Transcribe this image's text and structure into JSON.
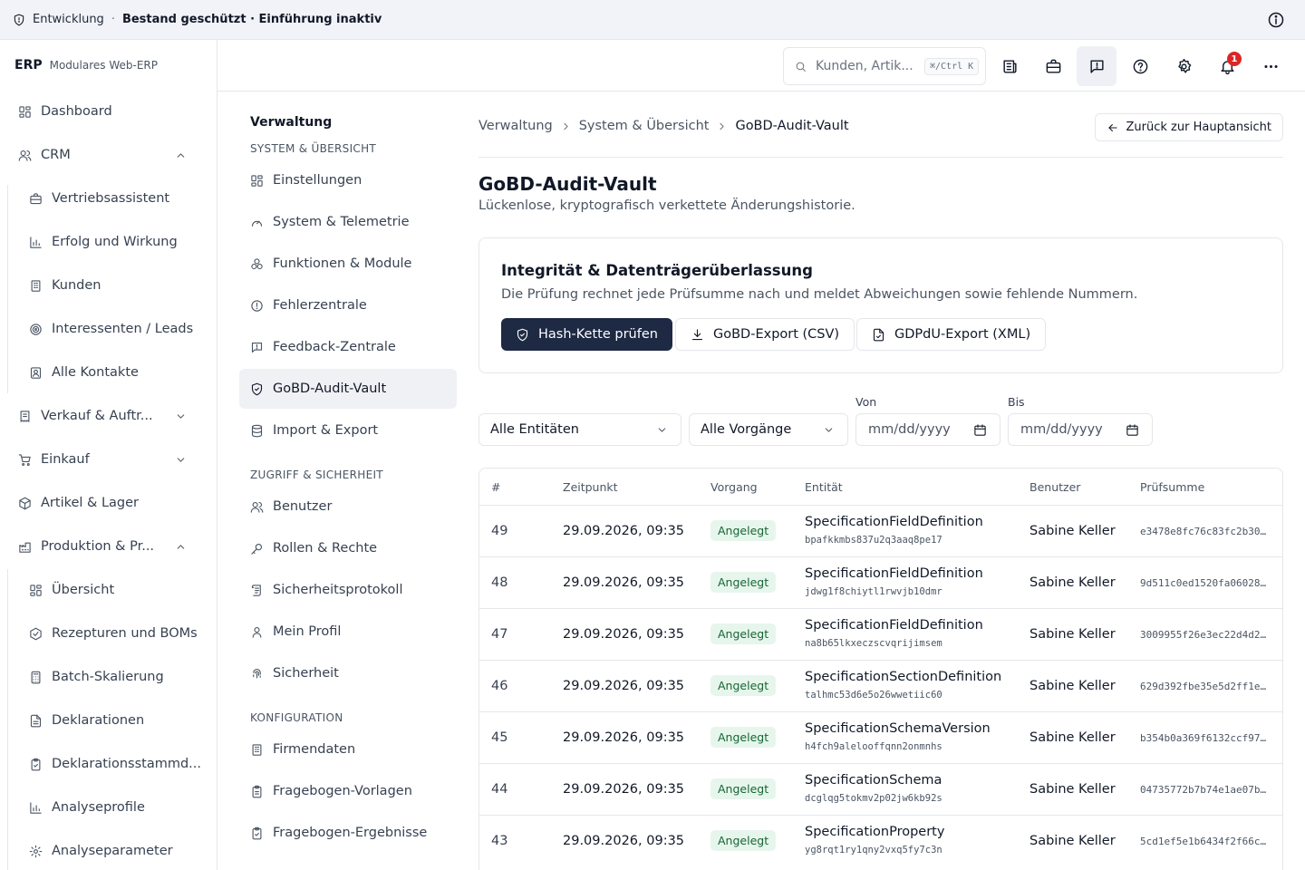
{
  "env": {
    "name": "Entwicklung",
    "separator": "·",
    "status": "Bestand geschützt · Einführung inaktiv"
  },
  "brand": {
    "short": "ERP",
    "long": "Modulares Web-ERP"
  },
  "sidebar": {
    "items": [
      {
        "label": "Dashboard",
        "icon": "dashboard-icon"
      },
      {
        "label": "CRM",
        "icon": "users-icon",
        "expanded": true
      },
      {
        "label": "Vertriebsassistent",
        "icon": "briefcase-icon"
      },
      {
        "label": "Erfolg und Wirkung",
        "icon": "bar-chart-icon"
      },
      {
        "label": "Kunden",
        "icon": "building-icon"
      },
      {
        "label": "Interessenten / Leads",
        "icon": "target-icon"
      },
      {
        "label": "Alle Kontakte",
        "icon": "contact-card-icon"
      },
      {
        "label": "Verkauf & Auftr...",
        "icon": "receipt-icon",
        "expanded": false
      },
      {
        "label": "Einkauf",
        "icon": "cart-icon",
        "expanded": false
      },
      {
        "label": "Artikel & Lager",
        "icon": "package-icon"
      },
      {
        "label": "Produktion & Pr...",
        "icon": "flask-icon",
        "expanded": true
      },
      {
        "label": "Übersicht",
        "icon": "dashboard-icon"
      },
      {
        "label": "Rezepturen und BOMs",
        "icon": "beaker-icon"
      },
      {
        "label": "Batch-Skalierung",
        "icon": "calculator-icon"
      },
      {
        "label": "Deklarationen",
        "icon": "file-text-icon"
      },
      {
        "label": "Deklarationsstammd...",
        "icon": "clipboard-check-icon"
      },
      {
        "label": "Analyseprofile",
        "icon": "bar-chart-icon"
      },
      {
        "label": "Analyseparameter",
        "icon": "gear-icon"
      }
    ]
  },
  "header": {
    "search_placeholder": "Kunden, Artik...",
    "search_shortcut": "⌘/Ctrl K",
    "notifications_count": "1"
  },
  "subnav": {
    "title": "Verwaltung",
    "sections": [
      {
        "label": "SYSTEM & ÜBERSICHT",
        "items": [
          {
            "label": "Einstellungen",
            "icon": "dashboard-icon"
          },
          {
            "label": "System & Telemetrie",
            "icon": "gauge-icon"
          },
          {
            "label": "Funktionen & Module",
            "icon": "modules-icon"
          },
          {
            "label": "Fehlerzentrale",
            "icon": "alert-circle-icon"
          },
          {
            "label": "Feedback-Zentrale",
            "icon": "feedback-icon"
          },
          {
            "label": "GoBD-Audit-Vault",
            "icon": "shield-check-icon",
            "active": true
          },
          {
            "label": "Import & Export",
            "icon": "database-icon"
          }
        ]
      },
      {
        "label": "ZUGRIFF & SICHERHEIT",
        "items": [
          {
            "label": "Benutzer",
            "icon": "users-icon"
          },
          {
            "label": "Rollen & Rechte",
            "icon": "key-icon"
          },
          {
            "label": "Sicherheitsprotokoll",
            "icon": "scroll-icon"
          },
          {
            "label": "Mein Profil",
            "icon": "user-icon"
          },
          {
            "label": "Sicherheit",
            "icon": "fingerprint-icon"
          }
        ]
      },
      {
        "label": "KONFIGURATION",
        "items": [
          {
            "label": "Firmendaten",
            "icon": "building-icon"
          },
          {
            "label": "Fragebogen-Vorlagen",
            "icon": "clipboard-icon"
          },
          {
            "label": "Fragebogen-Ergebnisse",
            "icon": "clipboard-check-icon"
          }
        ]
      }
    ]
  },
  "breadcrumb": [
    "Verwaltung",
    "System & Übersicht",
    "GoBD-Audit-Vault"
  ],
  "back_button": "Zurück zur Hauptansicht",
  "page": {
    "title": "GoBD-Audit-Vault",
    "subtitle": "Lückenlose, kryptografisch verkettete Änderungshistorie."
  },
  "integrity": {
    "title": "Integrität & Datenträgerüberlassung",
    "description": "Die Prüfung rechnet jede Prüfsumme nach und meldet Abweichungen sowie fehlende Nummern.",
    "buttons": {
      "verify": "Hash-Kette prüfen",
      "csv": "GoBD-Export (CSV)",
      "xml": "GDPdU-Export (XML)"
    }
  },
  "filters": {
    "entity": "Alle Entitäten",
    "action": "Alle Vorgänge",
    "from_label": "Von",
    "to_label": "Bis",
    "from_placeholder": "mm/dd/yyyy",
    "to_placeholder": "mm/dd/yyyy"
  },
  "table": {
    "columns": [
      "#",
      "Zeitpunkt",
      "Vorgang",
      "Entität",
      "Benutzer",
      "Prüfsumme"
    ],
    "rows": [
      {
        "num": "49",
        "time": "29.09.2026, 09:35",
        "action": "Angelegt",
        "entity": "SpecificationFieldDefinition",
        "id": "bpafkkmbs837u2q3aaq8pe17",
        "user": "Sabine Keller",
        "hash": "e3478e8fc76c83fc2b30..."
      },
      {
        "num": "48",
        "time": "29.09.2026, 09:35",
        "action": "Angelegt",
        "entity": "SpecificationFieldDefinition",
        "id": "jdwg1f8chiytl1rwvjb10dmr",
        "user": "Sabine Keller",
        "hash": "9d511c0ed1520fa06028..."
      },
      {
        "num": "47",
        "time": "29.09.2026, 09:35",
        "action": "Angelegt",
        "entity": "SpecificationFieldDefinition",
        "id": "na8b65lkxeczscvqrijimsem",
        "user": "Sabine Keller",
        "hash": "3009955f26e3ec22d4d2..."
      },
      {
        "num": "46",
        "time": "29.09.2026, 09:35",
        "action": "Angelegt",
        "entity": "SpecificationSectionDefinition",
        "id": "talhmc53d6e5o26wwetiic60",
        "user": "Sabine Keller",
        "hash": "629d392fbe35e5d2ff1e..."
      },
      {
        "num": "45",
        "time": "29.09.2026, 09:35",
        "action": "Angelegt",
        "entity": "SpecificationSchemaVersion",
        "id": "h4fch9alelooffqnn2onmnhs",
        "user": "Sabine Keller",
        "hash": "b354b0a369f6132ccf97..."
      },
      {
        "num": "44",
        "time": "29.09.2026, 09:35",
        "action": "Angelegt",
        "entity": "SpecificationSchema",
        "id": "dcglqg5tokmv2p02jw6kb92s",
        "user": "Sabine Keller",
        "hash": "04735772b7b74e1ae07b..."
      },
      {
        "num": "43",
        "time": "29.09.2026, 09:35",
        "action": "Angelegt",
        "entity": "SpecificationProperty",
        "id": "yg8rqt1ry1qny2vxq5fy7c3n",
        "user": "Sabine Keller",
        "hash": "5cd1ef5e1b6434f2f66c..."
      }
    ]
  },
  "colors": {
    "primary_button": "#1e2a44",
    "badge_bg": "#e7f6ec",
    "badge_text": "#166534",
    "notification": "#dc2626",
    "env_bar": "#f1f3f8"
  }
}
